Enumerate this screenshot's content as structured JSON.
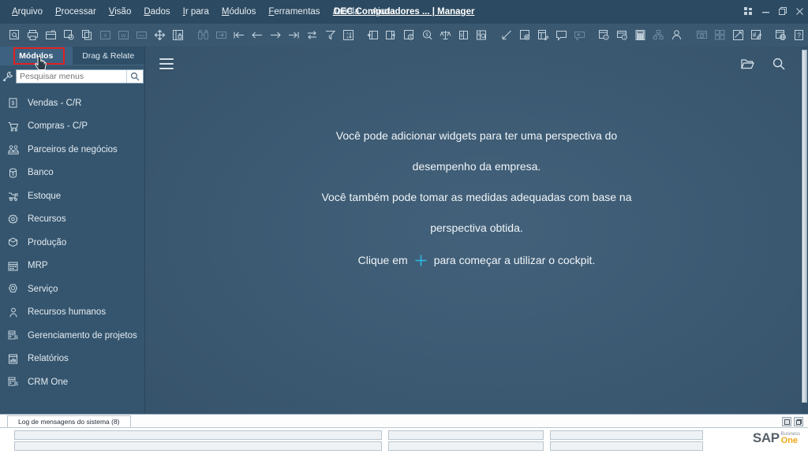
{
  "window": {
    "title": "OEC Computadores ... | Manager",
    "controls": [
      {
        "name": "apps-grid-icon",
        "glyph": "▦"
      },
      {
        "name": "minimize-icon",
        "glyph": "—"
      },
      {
        "name": "restore-icon",
        "glyph": "❐"
      },
      {
        "name": "close-icon",
        "glyph": "✕"
      }
    ]
  },
  "menubar": {
    "items": [
      {
        "label": "Arquivo",
        "accel": "A"
      },
      {
        "label": "Processar",
        "accel": "P"
      },
      {
        "label": "Visão",
        "accel": "V"
      },
      {
        "label": "Dados",
        "accel": "D"
      },
      {
        "label": "Ir para",
        "accel": "I"
      },
      {
        "label": "Módulos",
        "accel": "M"
      },
      {
        "label": "Ferramentas",
        "accel": "F"
      },
      {
        "label": "Janela",
        "accel": "J"
      },
      {
        "label": "Ajuda",
        "accel": "u"
      }
    ]
  },
  "toolbar": {
    "groups": [
      [
        "find-icon",
        "print-icon",
        "print-preview-icon",
        "preview-comment-icon",
        "copy-icon",
        "export-excel-icon",
        "export-word-icon",
        "export-pdf-icon",
        "move-icon",
        "lock-layout-icon"
      ],
      [
        "binoculars-icon",
        "next-record-icon",
        "first-record-icon",
        "previous-record-icon",
        "next-arrow-icon",
        "last-record-icon",
        "swap-icon",
        "filter-icon",
        "sort-az-icon"
      ],
      [
        "form-settings-icon",
        "add-row-icon",
        "gross-profit-icon",
        "currency-icon",
        "balance-icon",
        "split-icon",
        "query-icon"
      ],
      [
        "edit-arrow-icon",
        "form-gear-icon",
        "layout-designer-icon",
        "messages-icon",
        "reply-icon"
      ],
      [
        "info-report-icon",
        "info-window-icon",
        "calculator-icon",
        "org-chart-icon",
        "user-icon"
      ],
      [
        "dashboard-icon",
        "widgets-icon",
        "performance-icon",
        "signature-icon"
      ],
      [
        "web-browser-icon",
        "help-icon"
      ]
    ]
  },
  "sidebar": {
    "tabs": [
      {
        "label": "Módulos",
        "active": true
      },
      {
        "label": "Drag & Relate",
        "active": false
      }
    ],
    "search": {
      "placeholder": "Pesquisar menus",
      "value": "",
      "wrench_icon": "settings-wrench-icon",
      "go_icon": "search-icon"
    },
    "items": [
      {
        "label": "Vendas - C/R",
        "icon": "sales-invoice-icon"
      },
      {
        "label": "Compras - C/P",
        "icon": "purchase-cart-icon"
      },
      {
        "label": "Parceiros de negócios",
        "icon": "business-partners-icon"
      },
      {
        "label": "Banco",
        "icon": "banking-money-icon"
      },
      {
        "label": "Estoque",
        "icon": "inventory-icon"
      },
      {
        "label": "Recursos",
        "icon": "resources-gear-icon"
      },
      {
        "label": "Produção",
        "icon": "production-icon"
      },
      {
        "label": "MRP",
        "icon": "mrp-planning-icon"
      },
      {
        "label": "Serviço",
        "icon": "service-icon"
      },
      {
        "label": "Recursos humanos",
        "icon": "human-resources-icon"
      },
      {
        "label": "Gerenciamento de projetos",
        "icon": "project-management-icon"
      },
      {
        "label": "Relatórios",
        "icon": "reports-icon"
      },
      {
        "label": "CRM One",
        "icon": "crm-one-icon"
      }
    ]
  },
  "content": {
    "header": {
      "menu_icon": "hamburger-menu-icon",
      "folder_icon": "folder-icon",
      "search_icon": "search-icon"
    },
    "cockpit_message": {
      "line1": "Você pode adicionar widgets para ter uma perspectiva do",
      "line2": "desempenho da empresa.",
      "line3": "Você também pode tomar as medidas adequadas com base na",
      "line4": "perspectiva obtida.",
      "line5_prefix": "Clique em",
      "line5_plus": "+",
      "line5_suffix": "para começar a utilizar o cockpit."
    }
  },
  "status": {
    "log_tab": "Log de mensagens do sistema (8)",
    "log_buttons": [
      "restore-log-icon",
      "maximize-log-icon"
    ],
    "logo": {
      "sap": "SAP",
      "business": "Business",
      "one": "One"
    }
  },
  "colors": {
    "titlebar": "#2c4a61",
    "toolbar": "#3a5870",
    "sidebar": "#35556e",
    "content": "#3a5870",
    "accent_plus": "#2eb8e6",
    "highlight_box": "#e02020",
    "logo_orange": "#f0a818"
  }
}
